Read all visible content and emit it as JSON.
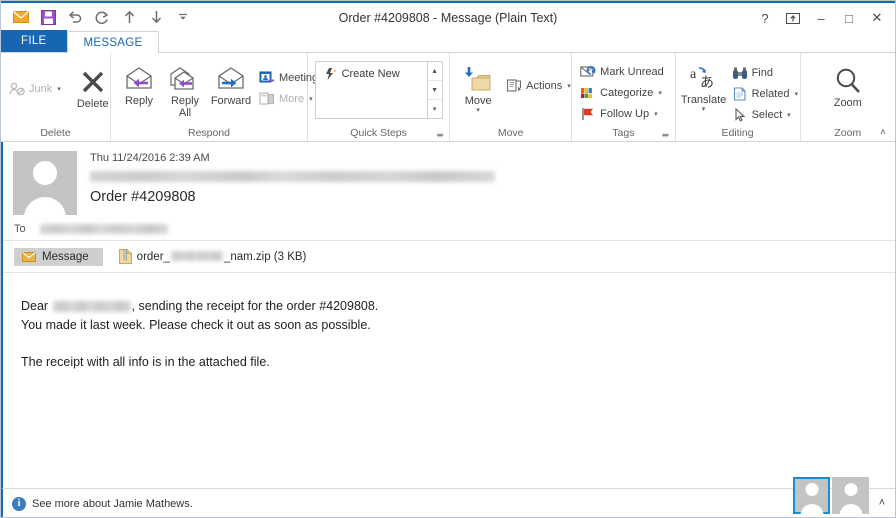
{
  "window": {
    "title": "Order #4209808 - Message (Plain Text)",
    "accent_color": "#1666b4",
    "quick_access": [
      {
        "name": "mail-icon",
        "label": "Mail"
      },
      {
        "name": "save-icon",
        "label": "Save"
      },
      {
        "name": "undo-icon",
        "label": "Undo"
      },
      {
        "name": "redo-icon",
        "label": "Redo"
      },
      {
        "name": "previous-item-icon",
        "label": "Previous Item"
      },
      {
        "name": "next-item-icon",
        "label": "Next Item"
      },
      {
        "name": "customize-quick-access-icon",
        "label": "Customize Quick Access Toolbar"
      }
    ],
    "controls": {
      "help": "?",
      "ribbon_display_options": "Ribbon Display Options",
      "minimize": "–",
      "maximize": "□",
      "close": "✕"
    }
  },
  "tabs": {
    "file": "FILE",
    "message": "MESSAGE"
  },
  "ribbon": {
    "collapse_label": "˄",
    "groups": {
      "delete": {
        "label": "Delete",
        "junk": "Junk",
        "delete": "Delete"
      },
      "respond": {
        "label": "Respond",
        "reply": "Reply",
        "reply_all": "Reply\nAll",
        "reply_all_line1": "Reply",
        "reply_all_line2": "All",
        "forward": "Forward",
        "meeting": "Meeting",
        "more": "More"
      },
      "quick_steps": {
        "label": "Quick Steps",
        "create_new": "Create New",
        "dialog_launcher": "⬌"
      },
      "move": {
        "label": "Move",
        "move": "Move",
        "actions": "Actions"
      },
      "tags": {
        "label": "Tags",
        "mark_unread": "Mark Unread",
        "categorize": "Categorize",
        "follow_up": "Follow Up",
        "dialog_launcher": "⬌"
      },
      "editing": {
        "label": "Editing",
        "translate": "Translate",
        "find": "Find",
        "related": "Related",
        "select": "Select"
      },
      "zoom": {
        "label": "Zoom",
        "zoom": "Zoom"
      }
    }
  },
  "message": {
    "sent_date": "Thu 11/24/2016 2:39 AM",
    "sender_redacted": true,
    "subject": "Order #4209808",
    "to_label": "To",
    "to_redacted": true,
    "message_tab": "Message",
    "attachment": {
      "prefix": "order_",
      "suffix": "_nam.zip (3 KB)",
      "size": "3 KB"
    },
    "body": {
      "line1_prefix": "Dear ",
      "line1_suffix": ", sending the receipt for the order #4209808.",
      "line2": "You made it last week. Please check it out as soon as possible.",
      "line3": "The receipt with all info is in the attached file."
    }
  },
  "footer": {
    "info_glyph": "i",
    "see_more": "See more about Jamie Mathews.",
    "expand_glyph": "˄",
    "people": [
      {
        "name": "person-tile-1",
        "selected": true
      },
      {
        "name": "person-tile-2",
        "selected": false
      }
    ]
  }
}
